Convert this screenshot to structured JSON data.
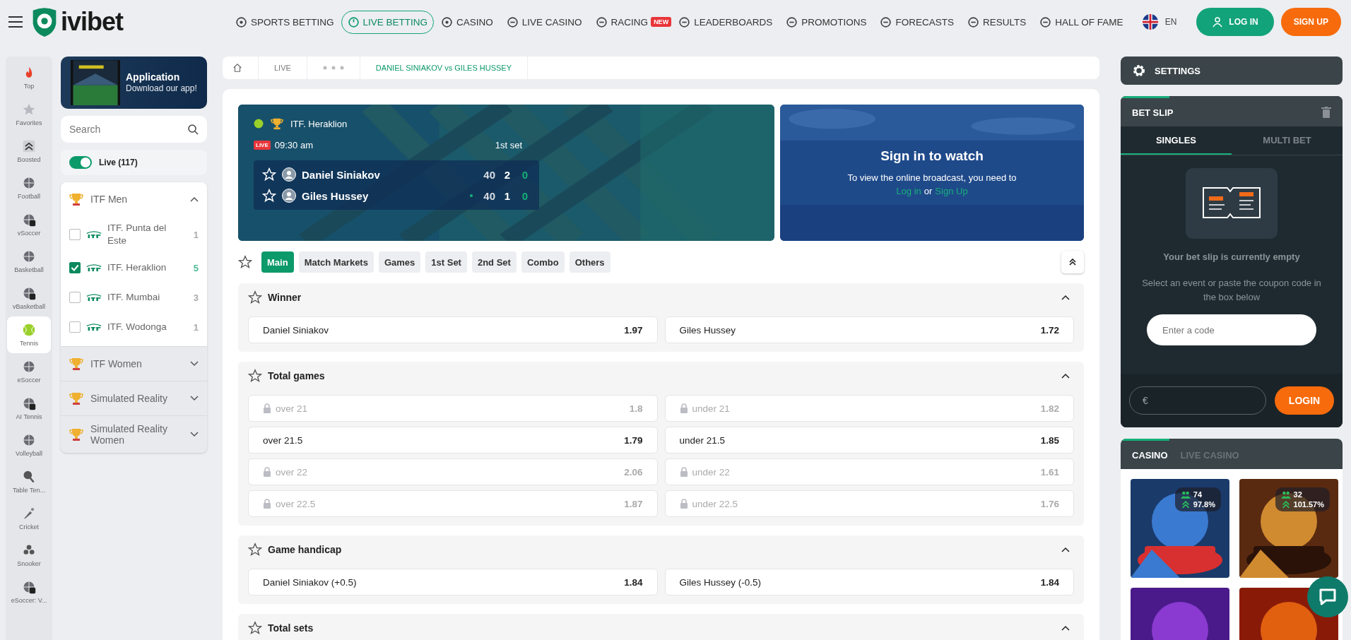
{
  "header": {
    "logo": "ivibet",
    "nav": [
      {
        "label": "SPORTS BETTING",
        "selected": false
      },
      {
        "label": "LIVE BETTING",
        "selected": true
      },
      {
        "label": "CASINO",
        "selected": false
      },
      {
        "label": "LIVE CASINO",
        "selected": false
      },
      {
        "label": "RACING",
        "selected": false,
        "badge": "NEW"
      },
      {
        "label": "LEADERBOARDS",
        "selected": false
      },
      {
        "label": "PROMOTIONS",
        "selected": false
      },
      {
        "label": "FORECASTS",
        "selected": false
      },
      {
        "label": "RESULTS",
        "selected": false
      },
      {
        "label": "HALL OF FAME",
        "selected": false
      }
    ],
    "language": "EN",
    "login": "LOG IN",
    "signup": "SIGN UP"
  },
  "sports_rail": [
    {
      "label": "Top",
      "selected": false
    },
    {
      "label": "Favorites",
      "selected": false
    },
    {
      "label": "Boosted",
      "selected": false
    },
    {
      "label": "Football",
      "selected": false
    },
    {
      "label": "vSoccer",
      "selected": false
    },
    {
      "label": "Basketball",
      "selected": false
    },
    {
      "label": "vBasketball",
      "selected": false
    },
    {
      "label": "Tennis",
      "selected": true
    },
    {
      "label": "eSoccer",
      "selected": false
    },
    {
      "label": "AI Tennis",
      "selected": false
    },
    {
      "label": "Volleyball",
      "selected": false
    },
    {
      "label": "Table Ten...",
      "selected": false
    },
    {
      "label": "Cricket",
      "selected": false
    },
    {
      "label": "Snooker",
      "selected": false
    },
    {
      "label": "eSoccer: V...",
      "selected": false
    }
  ],
  "sidebar": {
    "app_banner": {
      "title": "Application",
      "text": "Download our app!"
    },
    "search": {
      "placeholder": "Search"
    },
    "live_toggle": {
      "label": "Live (117)",
      "on": true
    },
    "categories": [
      {
        "name": "ITF Men",
        "expanded": true,
        "children": [
          {
            "name": "ITF. Punta del Este",
            "count": "1",
            "checked": false
          },
          {
            "name": "ITF. Heraklion",
            "count": "5",
            "checked": true
          },
          {
            "name": "ITF. Mumbai",
            "count": "3",
            "checked": false
          },
          {
            "name": "ITF. Wodonga",
            "count": "1",
            "checked": false
          }
        ]
      },
      {
        "name": "ITF Women",
        "expanded": false
      },
      {
        "name": "Simulated Reality",
        "expanded": false
      },
      {
        "name": "Simulated Reality Women",
        "expanded": false
      }
    ]
  },
  "breadcrumb": [
    {
      "kind": "home"
    },
    {
      "kind": "link",
      "label": "LIVE"
    },
    {
      "kind": "dots"
    },
    {
      "kind": "current",
      "label": "DANIEL SINIAKOV vs GILES HUSSEY"
    }
  ],
  "match": {
    "tournament": "ITF. Heraklion",
    "live_badge": "LIVE",
    "time": "09:30 am",
    "period": "1st set",
    "players": [
      {
        "name": "Daniel Siniakov",
        "serving": false,
        "points": "40",
        "games": "2",
        "sets": "0"
      },
      {
        "name": "Giles Hussey",
        "serving": true,
        "points": "40",
        "games": "1",
        "sets": "0"
      }
    ],
    "broadcast": {
      "title": "Sign in to watch",
      "text": "To view the online broadcast, you need to",
      "login_link": "Log in",
      "or": "or",
      "signup_link": "Sign Up"
    }
  },
  "market_tabs": [
    {
      "label": "Main",
      "selected": true
    },
    {
      "label": "Match Markets",
      "selected": false
    },
    {
      "label": "Games",
      "selected": false
    },
    {
      "label": "1st Set",
      "selected": false
    },
    {
      "label": "2nd Set",
      "selected": false
    },
    {
      "label": "Combo",
      "selected": false
    },
    {
      "label": "Others",
      "selected": false
    }
  ],
  "markets": [
    {
      "title": "Winner",
      "expanded": true,
      "rows": [
        [
          {
            "label": "Daniel Siniakov",
            "odds": "1.97",
            "locked": false
          },
          {
            "label": "Giles Hussey",
            "odds": "1.72",
            "locked": false
          }
        ]
      ]
    },
    {
      "title": "Total games",
      "expanded": true,
      "rows": [
        [
          {
            "label": "over 21",
            "odds": "1.8",
            "locked": true
          },
          {
            "label": "under 21",
            "odds": "1.82",
            "locked": true
          }
        ],
        [
          {
            "label": "over 21.5",
            "odds": "1.79",
            "locked": false
          },
          {
            "label": "under 21.5",
            "odds": "1.85",
            "locked": false
          }
        ],
        [
          {
            "label": "over 22",
            "odds": "2.06",
            "locked": true
          },
          {
            "label": "under 22",
            "odds": "1.61",
            "locked": true
          }
        ],
        [
          {
            "label": "over 22.5",
            "odds": "1.87",
            "locked": true
          },
          {
            "label": "under 22.5",
            "odds": "1.76",
            "locked": true
          }
        ]
      ]
    },
    {
      "title": "Game handicap",
      "expanded": true,
      "rows": [
        [
          {
            "label": "Daniel Siniakov (+0.5)",
            "odds": "1.84",
            "locked": false
          },
          {
            "label": "Giles Hussey (-0.5)",
            "odds": "1.84",
            "locked": false
          }
        ]
      ]
    },
    {
      "title": "Total sets",
      "expanded": true
    }
  ],
  "settings": {
    "label": "SETTINGS"
  },
  "bet_slip": {
    "title": "BET SLIP",
    "tabs": [
      {
        "label": "SINGLES",
        "selected": true
      },
      {
        "label": "MULTI BET",
        "selected": false
      }
    ],
    "empty_title": "Your bet slip is currently empty",
    "empty_text": "Select an event or paste the coupon code in the box below",
    "code_placeholder": "Enter a code",
    "stake_placeholder": "€",
    "login": "LOGIN"
  },
  "casino": {
    "tabs": [
      {
        "label": "CASINO",
        "selected": true
      },
      {
        "label": "LIVE CASINO",
        "selected": false
      }
    ],
    "games": [
      {
        "kind": "picture",
        "players": "74",
        "rtp": "97.8%"
      },
      {
        "kind": "picture",
        "players": "32",
        "rtp": "101.57%"
      },
      {
        "kind": "picture"
      },
      {
        "kind": "picture"
      }
    ]
  }
}
